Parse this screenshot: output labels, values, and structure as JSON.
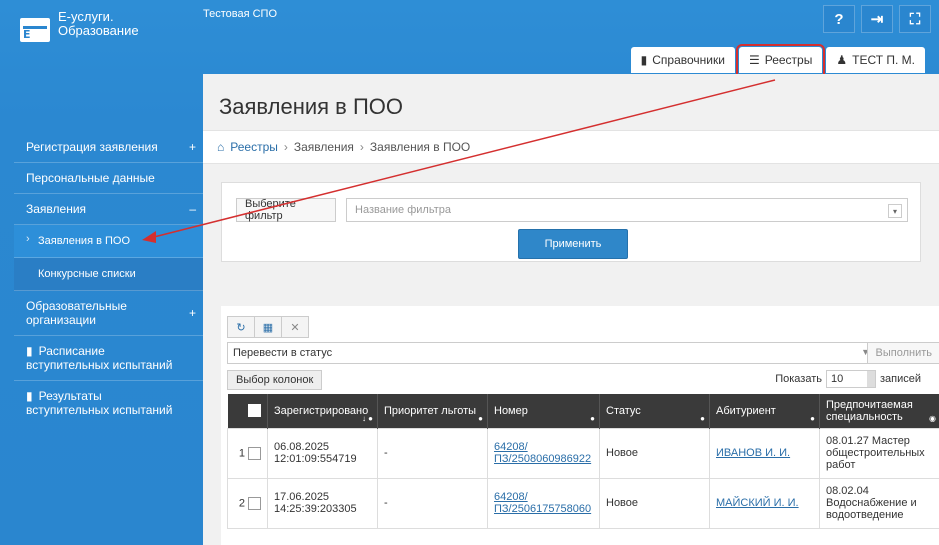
{
  "app": {
    "title_line1": "Е-услуги.",
    "title_line2": "Образование",
    "org": "Тестовая СПО"
  },
  "top_icons": [
    "?",
    "⇥",
    "⛶"
  ],
  "top_tabs": [
    {
      "icon": "book-icon",
      "label": "Справочники"
    },
    {
      "icon": "list-icon",
      "label": "Реестры",
      "active": true
    },
    {
      "icon": "user-icon",
      "label": "ТЕСТ П. М."
    }
  ],
  "sidebar": {
    "items": [
      {
        "label": "Регистрация заявления",
        "plus": "+"
      },
      {
        "label": "Персональные данные"
      },
      {
        "label": "Заявления",
        "plus": "–"
      },
      {
        "label": "Заявления в ПОО",
        "sub": true,
        "active": true
      },
      {
        "label": "Конкурсные списки",
        "sub": true
      },
      {
        "label": "Образовательные организации",
        "plus": "+"
      },
      {
        "label": "Расписание вступительных испытаний",
        "book": true
      },
      {
        "label": "Результаты вступительных испытаний",
        "book": true
      }
    ]
  },
  "page": {
    "title": "Заявления в ПОО"
  },
  "breadcrumb": [
    "Реестры",
    "Заявления",
    "Заявления в ПОО"
  ],
  "filter": {
    "label": "Выберите фильтр",
    "placeholder": "Название фильтра",
    "apply": "Применить"
  },
  "grid": {
    "status_label": "Перевести в статус",
    "execute": "Выполнить",
    "columns_button": "Выбор колонок",
    "show_label": "Показать",
    "show_value": "10",
    "records_label": "записей",
    "headers": [
      "Зарегистрировано",
      "Приоритет льготы",
      "Номер",
      "Статус",
      "Абитуриент",
      "Предпочитаемая специальность"
    ],
    "rows": [
      {
        "n": "1",
        "date": "06.08.2025",
        "time": "12:01:09:554719",
        "priority": "-",
        "num1": "64208/",
        "num2": "ПЗ/2508060986922",
        "status": "Новое",
        "applicant": "ИВАНОВ И. И.",
        "spec": "08.01.27 Мастер общестроительных работ"
      },
      {
        "n": "2",
        "date": "17.06.2025",
        "time": "14:25:39:203305",
        "priority": "-",
        "num1": "64208/",
        "num2": "ПЗ/2506175758060",
        "status": "Новое",
        "applicant": "МАЙСКИЙ И. И.",
        "spec": "08.02.04 Водоснабжение и водоотведение"
      }
    ]
  }
}
